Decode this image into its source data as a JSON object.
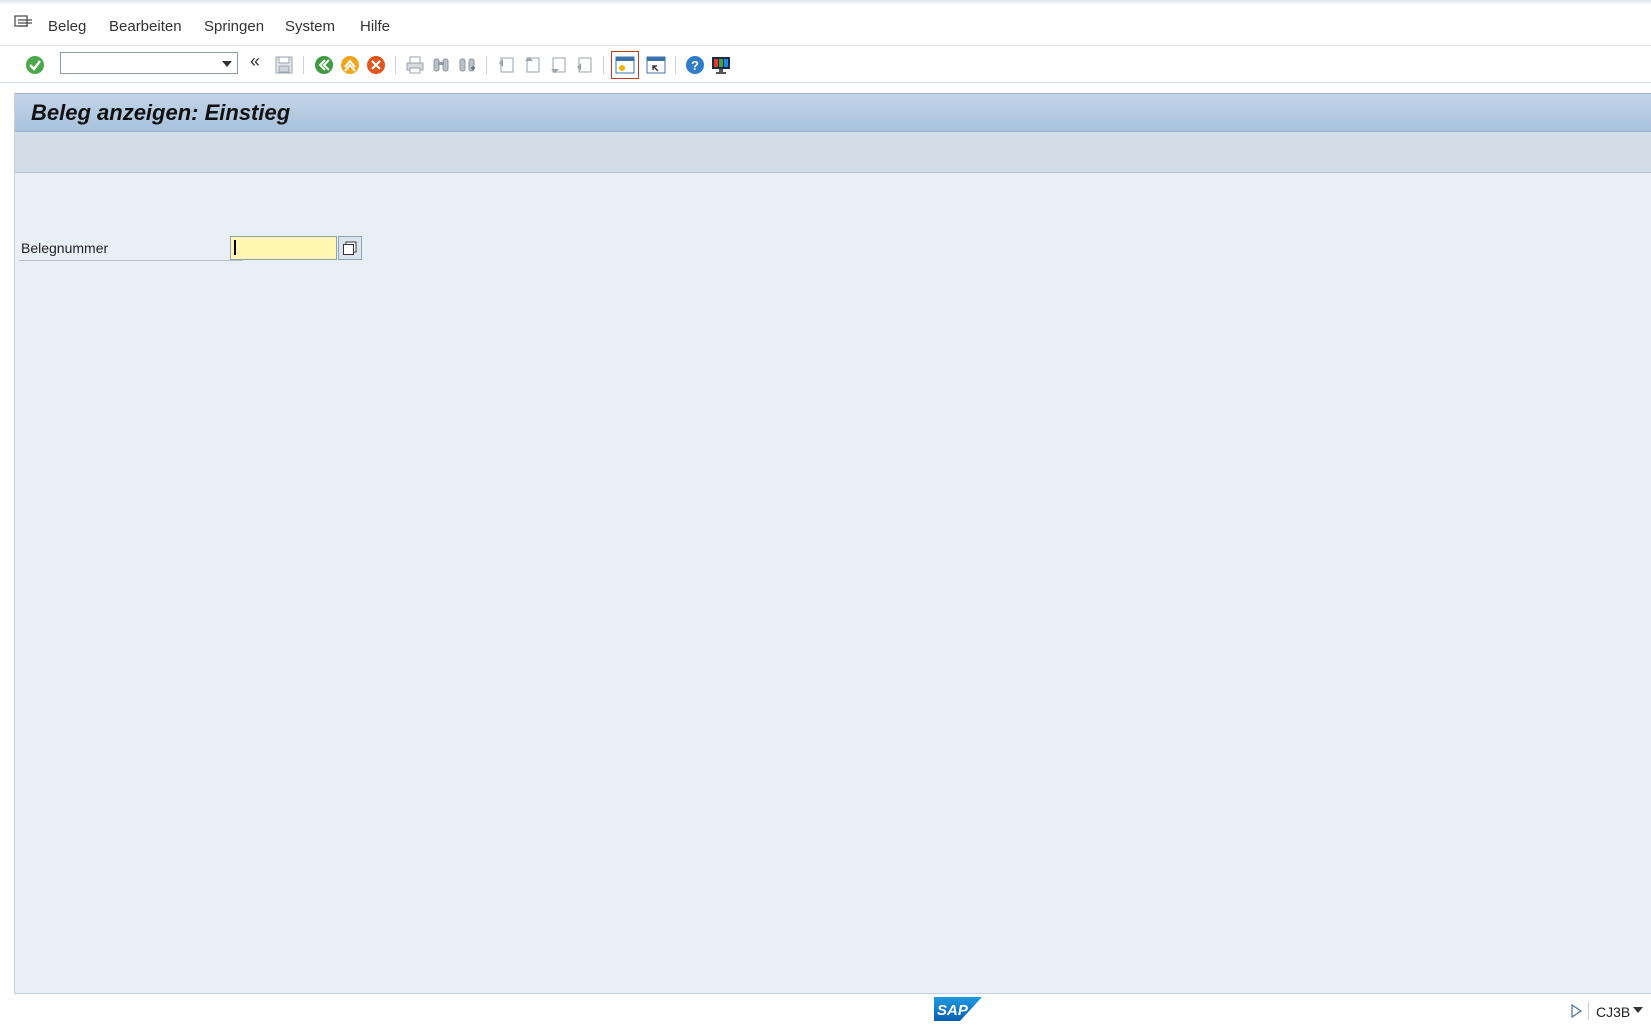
{
  "menu": {
    "items": [
      {
        "label": "Beleg"
      },
      {
        "label": "Bearbeiten"
      },
      {
        "label": "Springen"
      },
      {
        "label": "System"
      },
      {
        "label": "Hilfe"
      }
    ]
  },
  "toolbar": {
    "command_field_value": "",
    "history_glyph": "«",
    "icons": [
      "enter-icon",
      "save-icon",
      "back-icon",
      "exit-icon",
      "cancel-icon",
      "print-icon",
      "find-icon",
      "find-next-icon",
      "first-page-icon",
      "previous-page-icon",
      "next-page-icon",
      "last-page-icon",
      "new-session-icon",
      "create-shortcut-icon",
      "help-icon",
      "customize-layout-icon"
    ]
  },
  "screen": {
    "title": "Beleg anzeigen: Einstieg"
  },
  "form": {
    "belegnummer_label": "Belegnummer",
    "belegnummer_value": ""
  },
  "footer": {
    "logo_text": "SAP",
    "transaction_code": "CJ3B"
  },
  "colors": {
    "accent": "#a8c2dc",
    "background": "#e8eff6",
    "input_highlight": "#fff6b2"
  }
}
